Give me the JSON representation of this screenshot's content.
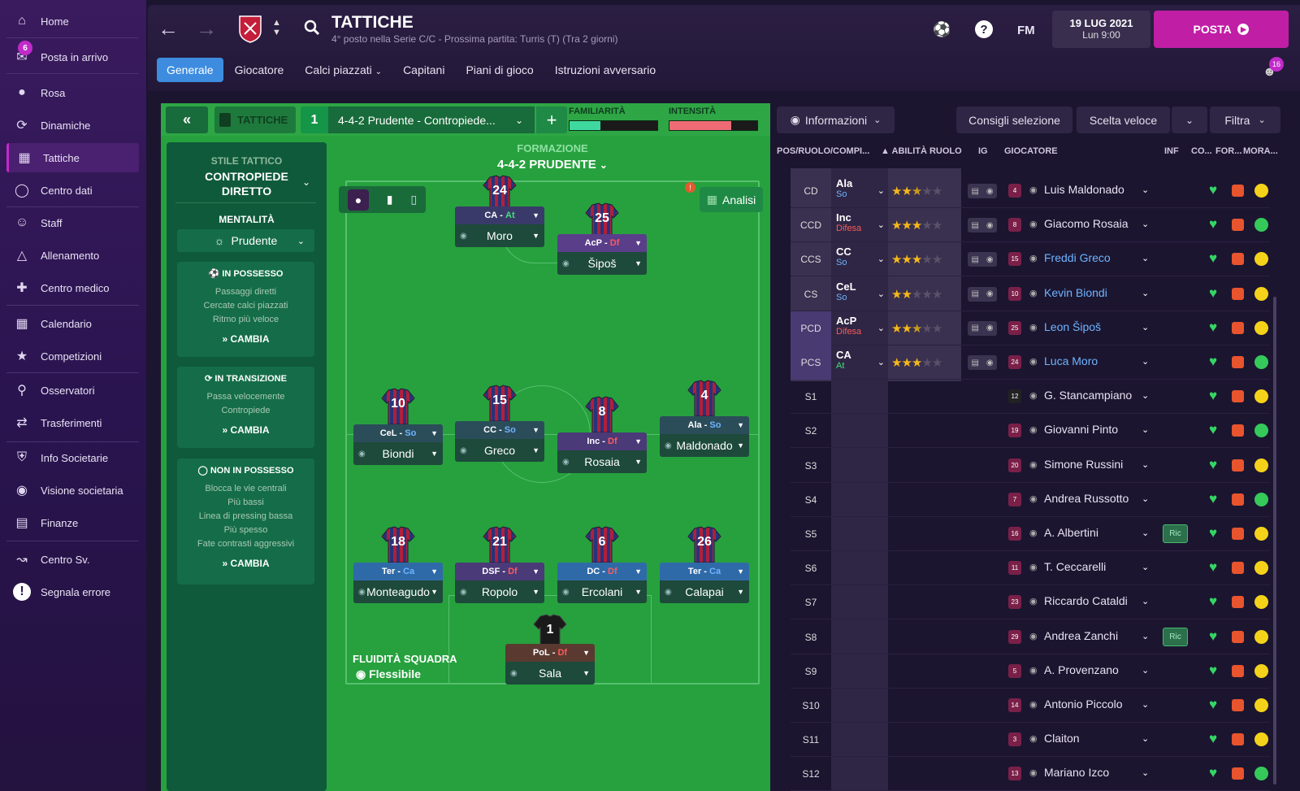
{
  "sidebar": {
    "items": [
      {
        "label": "Home",
        "icon": "home-icon"
      },
      {
        "label": "Posta in arrivo",
        "icon": "mail-icon",
        "badge": "6"
      },
      {
        "label": "Rosa",
        "icon": "shirt-icon"
      },
      {
        "label": "Dinamiche",
        "icon": "dynamics-icon"
      },
      {
        "label": "Tattiche",
        "icon": "tactics-icon"
      },
      {
        "label": "Centro dati",
        "icon": "data-icon"
      },
      {
        "label": "Staff",
        "icon": "staff-icon"
      },
      {
        "label": "Allenamento",
        "icon": "training-icon"
      },
      {
        "label": "Centro medico",
        "icon": "medical-icon"
      },
      {
        "label": "Calendario",
        "icon": "calendar-icon"
      },
      {
        "label": "Competizioni",
        "icon": "trophy-icon"
      },
      {
        "label": "Osservatori",
        "icon": "scout-icon"
      },
      {
        "label": "Trasferimenti",
        "icon": "transfer-icon"
      },
      {
        "label": "Info Societarie",
        "icon": "shield-icon"
      },
      {
        "label": "Visione societaria",
        "icon": "vision-icon"
      },
      {
        "label": "Finanze",
        "icon": "finance-icon"
      },
      {
        "label": "Centro Sv.",
        "icon": "dev-icon"
      },
      {
        "label": "Segnala errore",
        "icon": "alert-icon"
      }
    ]
  },
  "header": {
    "title": "TATTICHE",
    "subtitle": "4° posto nella Serie C/C - Prossima partita: Turris (T) (Tra 2 giorni)",
    "date": "19 LUG 2021",
    "time": "Lun 9:00",
    "posta": "POSTA",
    "fm": "FM",
    "help": "?",
    "notif": "16"
  },
  "tabs": [
    "Generale",
    "Giocatore",
    "Calci piazzati",
    "Capitani",
    "Piani di gioco",
    "Istruzioni avversario"
  ],
  "tactic": {
    "label": "TATTICHE",
    "number": "1",
    "name": "4-4-2 Prudente - Contropiede...",
    "familiarity_label": "FAMILIARITÀ",
    "intensity_label": "INTENSITÀ",
    "familiarity": 0.35,
    "intensity": 0.7,
    "formation_label": "FORMAZIONE",
    "formation": "4-4-2 PRUDENTE",
    "analisi": "Analisi",
    "fluidity_label": "FLUIDITÀ SQUADRA",
    "fluidity": "Flessibile"
  },
  "style": {
    "label": "STILE TATTICO",
    "name_line1": "CONTROPIEDE",
    "name_line2": "DIRETTO",
    "mentality_label": "MENTALITÀ",
    "mentality": "Prudente",
    "boxes": [
      {
        "head": "IN POSSESSO",
        "lines": [
          "Passaggi diretti",
          "Cercate calci piazzati",
          "Ritmo più veloce"
        ],
        "action": "CAMBIA"
      },
      {
        "head": "IN TRANSIZIONE",
        "lines": [
          "Passa velocemente",
          "Contropiede"
        ],
        "action": "CAMBIA"
      },
      {
        "head": "NON IN POSSESSO",
        "lines": [
          "Blocca le vie centrali",
          "Più bassi",
          "Linea di pressing bassa",
          "Più spesso",
          "Fate contrasti aggressivi"
        ],
        "action": "CAMBIA"
      }
    ]
  },
  "pitch_players": [
    {
      "num": "24",
      "role": "CA",
      "duty": "At",
      "name": "Moro"
    },
    {
      "num": "25",
      "role": "AcP",
      "duty": "Df",
      "name": "Šipoš"
    },
    {
      "num": "10",
      "role": "CeL",
      "duty": "So",
      "name": "Biondi"
    },
    {
      "num": "15",
      "role": "CC",
      "duty": "So",
      "name": "Greco"
    },
    {
      "num": "8",
      "role": "Inc",
      "duty": "Df",
      "name": "Rosaia"
    },
    {
      "num": "4",
      "role": "Ala",
      "duty": "So",
      "name": "Maldonado"
    },
    {
      "num": "18",
      "role": "Ter",
      "duty": "Ca",
      "name": "Monteagudo"
    },
    {
      "num": "21",
      "role": "DSF",
      "duty": "Df",
      "name": "Ropolo"
    },
    {
      "num": "6",
      "role": "DC",
      "duty": "Df",
      "name": "Ercolani"
    },
    {
      "num": "26",
      "role": "Ter",
      "duty": "Ca",
      "name": "Calapai"
    },
    {
      "num": "1",
      "role": "PoL",
      "duty": "Df",
      "name": "Sala"
    }
  ],
  "right": {
    "info_btn": "Informazioni",
    "consigli": "Consigli selezione",
    "scelta": "Scelta veloce",
    "filtra": "Filtra",
    "columns": [
      "POS/RUOLO/COMPI...",
      "ABILITÀ RUOLO",
      "IG",
      "GIOCATORE",
      "INF",
      "CO...",
      "FOR...",
      "MORA..."
    ],
    "rows": [
      {
        "pos": "CD",
        "role": "Ala",
        "duty": "So",
        "stars": 2.5,
        "num": "4",
        "name": "Luis Maldonado",
        "blue": false,
        "ric": "",
        "morale": "yellow"
      },
      {
        "pos": "CCD",
        "role": "Inc",
        "duty": "Difesa",
        "stars": 3,
        "num": "8",
        "name": "Giacomo Rosaia",
        "blue": false,
        "ric": "",
        "morale": "green"
      },
      {
        "pos": "CCS",
        "role": "CC",
        "duty": "So",
        "stars": 3,
        "num": "15",
        "name": "Freddi Greco",
        "blue": true,
        "ric": "",
        "morale": "yellow"
      },
      {
        "pos": "CS",
        "role": "CeL",
        "duty": "So",
        "stars": 2,
        "num": "10",
        "name": "Kevin Biondi",
        "blue": true,
        "ric": "",
        "morale": "yellow"
      },
      {
        "pos": "PCD",
        "role": "AcP",
        "duty": "Difesa",
        "stars": 2.5,
        "num": "25",
        "name": "Leon Šipoš",
        "blue": true,
        "ric": "",
        "morale": "yellow"
      },
      {
        "pos": "PCS",
        "role": "CA",
        "duty": "At",
        "stars": 3,
        "num": "24",
        "name": "Luca Moro",
        "blue": true,
        "ric": "",
        "morale": "green"
      },
      {
        "pos": "S1",
        "role": "",
        "duty": "",
        "stars": 0,
        "num": "12",
        "name": "G. Stancampiano",
        "blue": false,
        "ric": "",
        "morale": "yellow"
      },
      {
        "pos": "S2",
        "role": "",
        "duty": "",
        "stars": 0,
        "num": "19",
        "name": "Giovanni Pinto",
        "blue": false,
        "ric": "",
        "morale": "green"
      },
      {
        "pos": "S3",
        "role": "",
        "duty": "",
        "stars": 0,
        "num": "20",
        "name": "Simone Russini",
        "blue": false,
        "ric": "",
        "morale": "yellow"
      },
      {
        "pos": "S4",
        "role": "",
        "duty": "",
        "stars": 0,
        "num": "7",
        "name": "Andrea Russotto",
        "blue": false,
        "ric": "",
        "morale": "green"
      },
      {
        "pos": "S5",
        "role": "",
        "duty": "",
        "stars": 0,
        "num": "16",
        "name": "A. Albertini",
        "blue": false,
        "ric": "Ric",
        "morale": "yellow"
      },
      {
        "pos": "S6",
        "role": "",
        "duty": "",
        "stars": 0,
        "num": "11",
        "name": "T. Ceccarelli",
        "blue": false,
        "ric": "",
        "morale": "yellow"
      },
      {
        "pos": "S7",
        "role": "",
        "duty": "",
        "stars": 0,
        "num": "23",
        "name": "Riccardo Cataldi",
        "blue": false,
        "ric": "",
        "morale": "yellow"
      },
      {
        "pos": "S8",
        "role": "",
        "duty": "",
        "stars": 0,
        "num": "29",
        "name": "Andrea Zanchi",
        "blue": false,
        "ric": "Ric",
        "morale": "yellow"
      },
      {
        "pos": "S9",
        "role": "",
        "duty": "",
        "stars": 0,
        "num": "5",
        "name": "A. Provenzano",
        "blue": false,
        "ric": "",
        "morale": "yellow"
      },
      {
        "pos": "S10",
        "role": "",
        "duty": "",
        "stars": 0,
        "num": "14",
        "name": "Antonio Piccolo",
        "blue": false,
        "ric": "",
        "morale": "yellow"
      },
      {
        "pos": "S11",
        "role": "",
        "duty": "",
        "stars": 0,
        "num": "3",
        "name": "Claiton",
        "blue": false,
        "ric": "",
        "morale": "yellow"
      },
      {
        "pos": "S12",
        "role": "",
        "duty": "",
        "stars": 0,
        "num": "13",
        "name": "Mariano Izco",
        "blue": false,
        "ric": "",
        "morale": "green"
      }
    ]
  },
  "colors": {
    "accent": "#c01ea5",
    "pitch": "#26a13e",
    "tab_active": "#3d8ce0"
  }
}
